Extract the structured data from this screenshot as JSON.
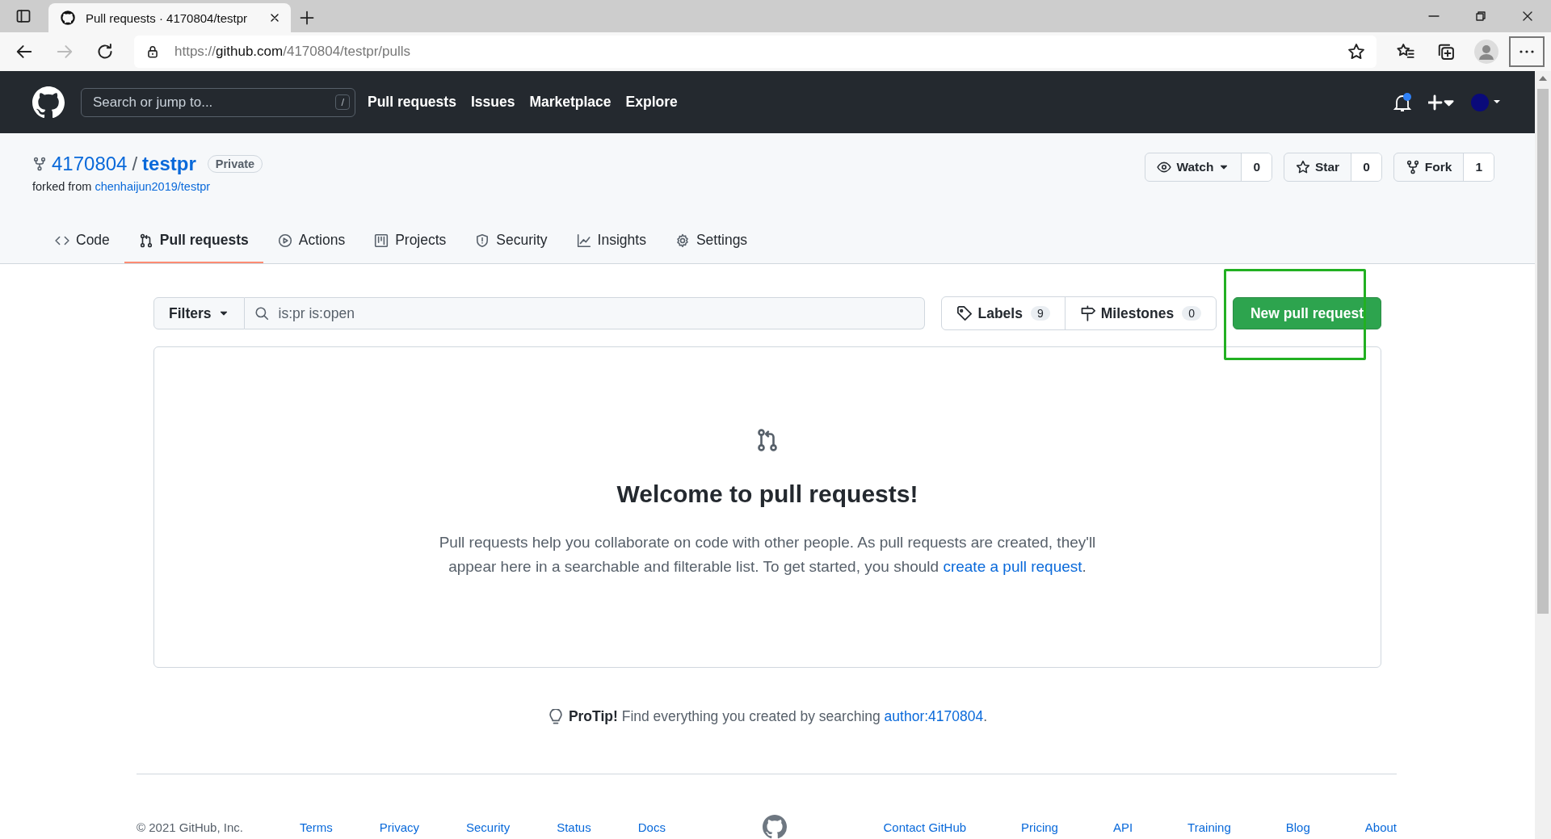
{
  "browser": {
    "tab_title": "Pull requests · 4170804/testpr",
    "url_scheme": "https://",
    "url_host": "github.com",
    "url_path": "/4170804/testpr/pulls"
  },
  "header": {
    "search_placeholder": "Search or jump to...",
    "search_key": "/",
    "nav": [
      "Pull requests",
      "Issues",
      "Marketplace",
      "Explore"
    ]
  },
  "repo": {
    "owner": "4170804",
    "separator": "/",
    "name": "testpr",
    "visibility": "Private",
    "forked_label": "forked from",
    "forked_link": "chenhaijun2019/testpr",
    "actions": [
      {
        "kind": "watch",
        "label": "Watch",
        "count": "0"
      },
      {
        "kind": "star",
        "label": "Star",
        "count": "0"
      },
      {
        "kind": "fork",
        "label": "Fork",
        "count": "1"
      }
    ],
    "tabs": [
      {
        "kind": "code",
        "label": "Code",
        "selected": false
      },
      {
        "kind": "pr",
        "label": "Pull requests",
        "selected": true
      },
      {
        "kind": "actions",
        "label": "Actions",
        "selected": false
      },
      {
        "kind": "projects",
        "label": "Projects",
        "selected": false
      },
      {
        "kind": "security",
        "label": "Security",
        "selected": false
      },
      {
        "kind": "insights",
        "label": "Insights",
        "selected": false
      },
      {
        "kind": "settings",
        "label": "Settings",
        "selected": false
      }
    ]
  },
  "toolbar": {
    "filters": "Filters",
    "query": "is:pr is:open",
    "labels": {
      "label": "Labels",
      "count": "9"
    },
    "milestones": {
      "label": "Milestones",
      "count": "0"
    },
    "new_button": "New pull request"
  },
  "blankslate": {
    "title": "Welcome to pull requests!",
    "text": "Pull requests help you collaborate on code with other people. As pull requests are created, they'll appear here in a searchable and filterable list. To get started, you should ",
    "link": "create a pull request",
    "after": "."
  },
  "protip": {
    "label": "ProTip!",
    "text": "Find everything you created by searching ",
    "link": "author:4170804",
    "after": "."
  },
  "footer": {
    "copyright": "© 2021 GitHub, Inc.",
    "left": [
      "Terms",
      "Privacy",
      "Security",
      "Status",
      "Docs"
    ],
    "right": [
      "Contact GitHub",
      "Pricing",
      "API",
      "Training",
      "Blog",
      "About"
    ]
  }
}
